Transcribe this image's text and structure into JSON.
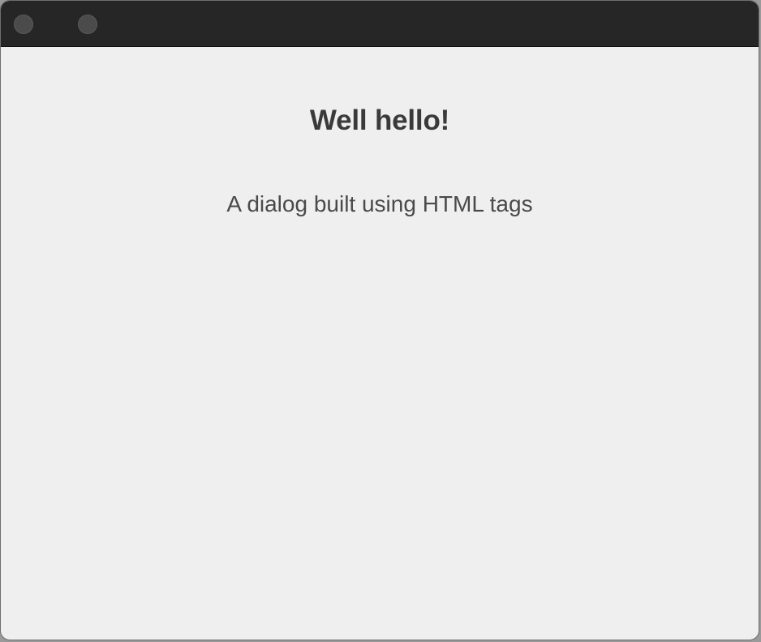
{
  "window": {
    "titlebar": {
      "buttons": [
        {
          "name": "close",
          "icon": "circle-icon"
        },
        {
          "name": "minimize",
          "icon": "circle-icon"
        }
      ]
    },
    "dialog": {
      "heading": "Well hello!",
      "message": "A dialog built using HTML tags"
    }
  },
  "colors": {
    "titlebar": "#262626",
    "content_bg": "#efefef",
    "traffic_light": "#4b4b4b",
    "heading_text": "#3a3a3a",
    "body_text": "#4a4a4a"
  }
}
